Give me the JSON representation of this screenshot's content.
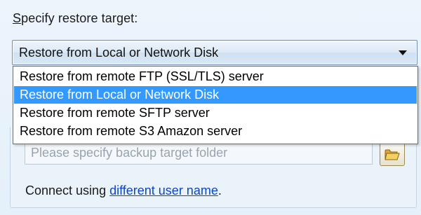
{
  "restore_target": {
    "heading_first_letter": "S",
    "heading_rest": "pecify restore target:",
    "selected_value": "Restore from Local or Network Disk",
    "options": [
      {
        "label": "Restore from remote FTP (SSL/TLS) server"
      },
      {
        "label": "Restore from Local or Network Disk"
      },
      {
        "label": "Restore from remote SFTP server"
      },
      {
        "label": "Restore from remote S3 Amazon server"
      }
    ],
    "highlighted_index": 1
  },
  "backup_folder": {
    "placeholder": "Please specify backup target folder",
    "browse_icon": "folder-open-icon"
  },
  "connect": {
    "prefix": "Connect using ",
    "link_label": "different user name",
    "suffix": "."
  },
  "colors": {
    "selection": "#3399ff",
    "link": "#0a46c8",
    "background": "#eaf3fb"
  }
}
